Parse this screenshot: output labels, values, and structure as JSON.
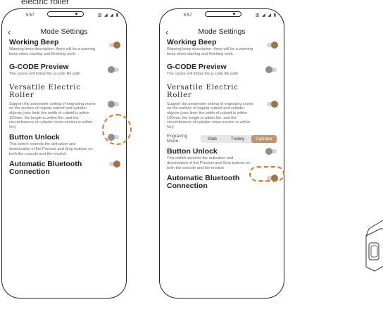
{
  "caption": "electric roller",
  "status": {
    "time": "5:57",
    "icons": "▥ ◢ ◢ ▮"
  },
  "nav": {
    "title": "Mode Settings"
  },
  "left_phone": {
    "settings": [
      {
        "title": "Working Beep",
        "desc": "Warning beep description: there will be a warning beep when starting and finishing work.",
        "state": "on"
      },
      {
        "title": "G-CODE Preview",
        "desc": "The cursor will follow the g-code file path",
        "state": "off"
      },
      {
        "title": "Versatile Electric Roller",
        "desc": "Support the parameter setting of engraving scene on the surface of regular cuboid and cylinder objects (size limit: the width of cuboid is within 100mm, the length is within 5m, and the circumference of cylinder cross section is within 5m)",
        "state": "off"
      },
      {
        "title": "Button Unlock",
        "desc": "This switch controls the activation and deactivation of the Preview and Stop buttons on both the console and the iovstick",
        "state": "off"
      },
      {
        "title": "Automatic Bluetooth Connection",
        "desc": "",
        "state": "on"
      }
    ]
  },
  "right_phone": {
    "settings": [
      {
        "title": "Working Beep",
        "desc": "Warning beep description: there will be a warning beep when starting and finishing work.",
        "state": "on"
      },
      {
        "title": "G-CODE Preview",
        "desc": "The cursor will follow the g-code file path",
        "state": "off"
      },
      {
        "title": "Versatile Electric Roller",
        "desc": "Support the parameter setting of engraving scene on the surface of regular cuboid and cylinder objects (size limit: the width of cuboid is within 100mm, the length is within 5m, and the circumference of cylinder cross section is within 5m)",
        "state": "on"
      },
      {
        "title": "Button Unlock",
        "desc": "This switch controls the activation and deactivation of the Preview and Stop buttons on both the console and the iovstick",
        "state": "off"
      },
      {
        "title": "Automatic Bluetooth Connection",
        "desc": "",
        "state": "on"
      }
    ],
    "engraving_mode": {
      "label": "Engraving Mode:",
      "options": [
        "Slab",
        "Trolley",
        "Cylinder"
      ],
      "selected": "Cylinder"
    }
  },
  "colors": {
    "accent": "#bf9470",
    "toggle_on_knob": "#9c7448",
    "highlight": "#e07326"
  },
  "icons": {
    "back": "chevron-left-icon"
  }
}
